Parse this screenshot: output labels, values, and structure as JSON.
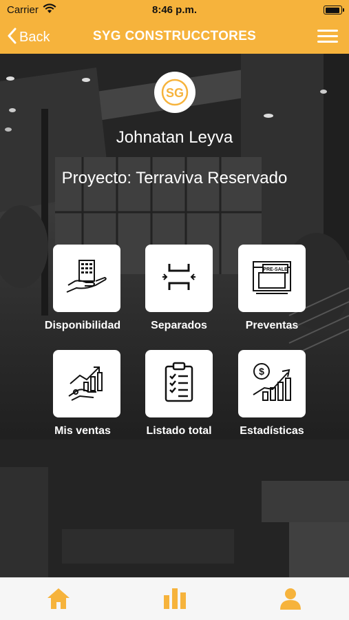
{
  "status_bar": {
    "carrier": "Carrier",
    "time": "8:46 p.m."
  },
  "nav": {
    "back_label": "Back",
    "title": "SYG CONSTRUCCTORES"
  },
  "profile": {
    "logo_text": "SG",
    "user_name": "Johnatan Leyva",
    "project": "Proyecto: Terraviva Reservado"
  },
  "menu": {
    "items": [
      {
        "label": "Disponibilidad",
        "icon": "building-hand-icon"
      },
      {
        "label": "Separados",
        "icon": "separator-icon"
      },
      {
        "label": "Preventas",
        "icon": "pre-sale-icon",
        "badge": "PRE-SALE"
      },
      {
        "label": "Mis ventas",
        "icon": "sales-growth-icon"
      },
      {
        "label": "Listado total",
        "icon": "checklist-icon"
      },
      {
        "label": "Estadísticas",
        "icon": "statistics-icon"
      }
    ]
  },
  "tab_bar": {
    "tabs": [
      "home-icon",
      "chart-icon",
      "profile-icon"
    ]
  },
  "colors": {
    "accent": "#f6b33c",
    "tab_icon": "#f6b33c",
    "background": "#2b2b2b",
    "tile": "#ffffff"
  }
}
